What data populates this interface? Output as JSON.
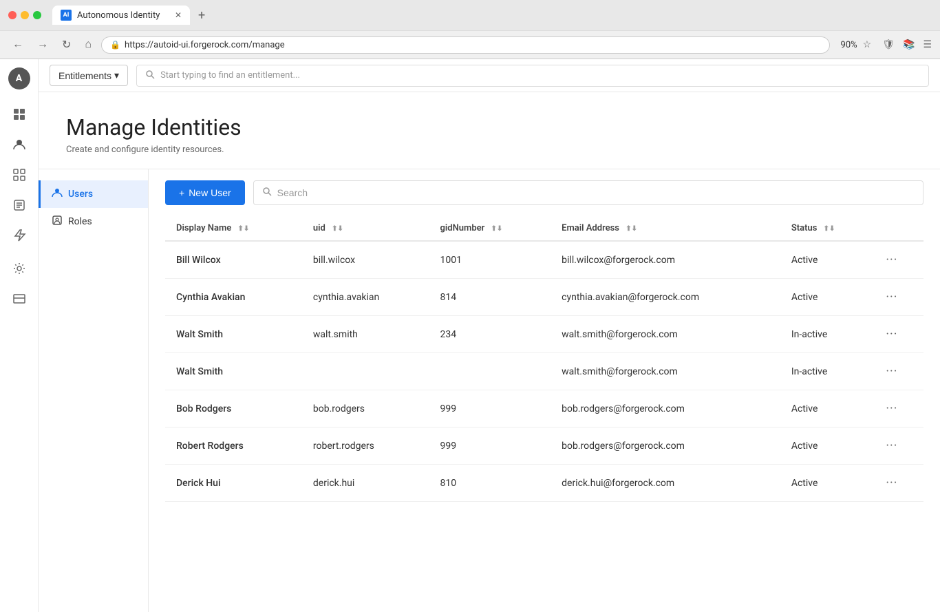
{
  "browser": {
    "dot_red": "red",
    "dot_yellow": "yellow",
    "dot_green": "green",
    "tab_label": "Autonomous Identity",
    "tab_icon": "AI",
    "url": "https://autoid-ui.forgerock.com/manage",
    "zoom": "90%",
    "new_tab_icon": "+"
  },
  "header": {
    "entitlements_label": "Entitlements",
    "search_placeholder": "Start typing to find an entitlement..."
  },
  "sidebar_icons": [
    {
      "name": "avatar",
      "label": "A"
    },
    {
      "name": "dashboard-icon",
      "symbol": "⊞"
    },
    {
      "name": "users-icon",
      "symbol": "👤"
    },
    {
      "name": "grid-icon",
      "symbol": "⊡"
    },
    {
      "name": "activity-icon",
      "symbol": "📋"
    },
    {
      "name": "layers-icon",
      "symbol": "⚡"
    },
    {
      "name": "settings-icon",
      "symbol": "⚙"
    },
    {
      "name": "table-icon",
      "symbol": "⊟"
    }
  ],
  "page": {
    "title": "Manage Identities",
    "subtitle": "Create and configure identity resources."
  },
  "nav": {
    "items": [
      {
        "id": "users",
        "label": "Users",
        "active": true,
        "icon": "👤"
      },
      {
        "id": "roles",
        "label": "Roles",
        "active": false,
        "icon": "🪪"
      }
    ]
  },
  "toolbar": {
    "new_user_label": "+ New User",
    "search_placeholder": "Search"
  },
  "table": {
    "columns": [
      {
        "id": "display_name",
        "label": "Display Name"
      },
      {
        "id": "uid",
        "label": "uid"
      },
      {
        "id": "gid_number",
        "label": "gidNumber"
      },
      {
        "id": "email_address",
        "label": "Email Address"
      },
      {
        "id": "status",
        "label": "Status"
      }
    ],
    "rows": [
      {
        "display_name": "Bill Wilcox",
        "uid": "bill.wilcox",
        "gid_number": "1001",
        "email": "bill.wilcox@forgerock.com",
        "status": "Active"
      },
      {
        "display_name": "Cynthia Avakian",
        "uid": "cynthia.avakian",
        "gid_number": "814",
        "email": "cynthia.avakian@forgerock.com",
        "status": "Active"
      },
      {
        "display_name": "Walt Smith",
        "uid": "walt.smith",
        "gid_number": "234",
        "email": "walt.smith@forgerock.com",
        "status": "In-active"
      },
      {
        "display_name": "Walt Smith",
        "uid": "",
        "gid_number": "",
        "email": "walt.smith@forgerock.com",
        "status": "In-active"
      },
      {
        "display_name": "Bob Rodgers",
        "uid": "bob.rodgers",
        "gid_number": "999",
        "email": "bob.rodgers@forgerock.com",
        "status": "Active"
      },
      {
        "display_name": "Robert Rodgers",
        "uid": "robert.rodgers",
        "gid_number": "999",
        "email": "bob.rodgers@forgerock.com",
        "status": "Active"
      },
      {
        "display_name": "Derick Hui",
        "uid": "derick.hui",
        "gid_number": "810",
        "email": "derick.hui@forgerock.com",
        "status": "Active"
      }
    ]
  },
  "colors": {
    "accent": "#1a73e8",
    "active_bg": "#e8f0fe",
    "border": "#e8e8e8"
  }
}
